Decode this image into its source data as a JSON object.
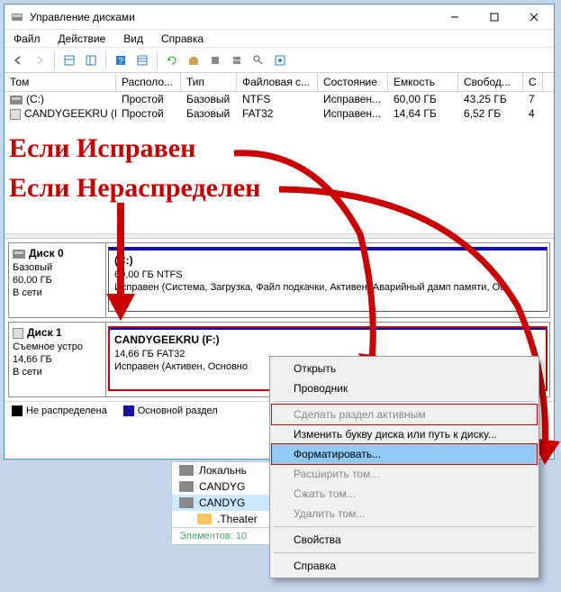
{
  "window": {
    "title": "Управление дисками"
  },
  "menu": {
    "file": "Файл",
    "action": "Действие",
    "view": "Вид",
    "help": "Справка"
  },
  "columns": {
    "volume": "Том",
    "layout": "Располо...",
    "type": "Тип",
    "filesystem": "Файловая с...",
    "status": "Состояние",
    "capacity": "Емкость",
    "free": "Свобод...",
    "pct": "С"
  },
  "volumes": [
    {
      "name": "(C:)",
      "layout": "Простой",
      "type": "Базовый",
      "fs": "NTFS",
      "status": "Исправен...",
      "cap": "60,00 ГБ",
      "free": "43,25 ГБ",
      "pct": "7"
    },
    {
      "name": "CANDYGEEKRU (F:)",
      "layout": "Простой",
      "type": "Базовый",
      "fs": "FAT32",
      "status": "Исправен...",
      "cap": "14,64 ГБ",
      "free": "6,52 ГБ",
      "pct": "4"
    }
  ],
  "overlay": {
    "line1": "Если Исправен",
    "line2": "Если Нераспределен"
  },
  "disk0": {
    "label": "Диск 0",
    "type": "Базовый",
    "size": "60,00 ГБ",
    "status": "В сети",
    "vol_name": "(C:)",
    "vol_size": "60,00 ГБ NTFS",
    "vol_status": "Исправен (Система, Загрузка, Файл подкачки, Активен, Аварийный дамп памяти, Ос"
  },
  "disk1": {
    "label": "Диск 1",
    "type": "Съемное устро",
    "size": "14,66 ГБ",
    "status": "В сети",
    "vol_name": "CANDYGEEKRU  (F:)",
    "vol_size": "14,66 ГБ FAT32",
    "vol_status": "Исправен (Активен, Основно"
  },
  "legend": {
    "unalloc": "Не распределена",
    "primary": "Основной раздел"
  },
  "ctx": {
    "open": "Открыть",
    "explorer": "Проводник",
    "active": "Сделать раздел активным",
    "letter": "Изменить букву диска или путь к диску...",
    "format": "Форматировать...",
    "extend": "Расширить том...",
    "shrink": "Сжать том...",
    "delete": "Удалить том...",
    "props": "Свойства",
    "help": "Справка"
  },
  "explorer": {
    "local": "Локальнь",
    "candyg1": "CANDYG",
    "candyg2": "CANDYG",
    "theater": ".Theater",
    "count_label": "Элементов: 10",
    "sel": ""
  }
}
